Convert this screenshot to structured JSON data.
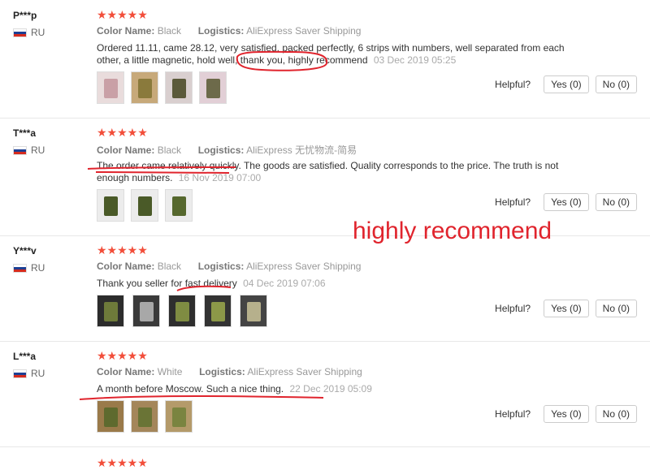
{
  "reviews": [
    {
      "user": "P***p",
      "country": "RU",
      "stars": "★★★★★",
      "color_label": "Color Name:",
      "color": "Black",
      "logistics_label": "Logistics:",
      "logistics": "AliExpress Saver Shipping",
      "text": "Ordered 11.11, came 28.12, very satisfied, packed perfectly, 6 strips with numbers, well separated from each other, a little magnetic, hold well, thank you, highly recommend",
      "date": "03 Dec 2019 05:25",
      "photos": 4,
      "helpful_label": "Helpful?",
      "yes_label": "Yes (0)",
      "no_label": "No (0)"
    },
    {
      "user": "T***a",
      "country": "RU",
      "stars": "★★★★★",
      "color_label": "Color Name:",
      "color": "Black",
      "logistics_label": "Logistics:",
      "logistics": "AliExpress 无忧物流-简易",
      "text": "The order came relatively quickly. The goods are satisfied. Quality corresponds to the price. The truth is not enough numbers.",
      "date": "16 Nov 2019 07:00",
      "photos": 3,
      "helpful_label": "Helpful?",
      "yes_label": "Yes (0)",
      "no_label": "No (0)"
    },
    {
      "user": "Y***v",
      "country": "RU",
      "stars": "★★★★★",
      "color_label": "Color Name:",
      "color": "Black",
      "logistics_label": "Logistics:",
      "logistics": "AliExpress Saver Shipping",
      "text": "Thank you seller for fast delivery",
      "date": "04 Dec 2019 07:06",
      "photos": 5,
      "helpful_label": "Helpful?",
      "yes_label": "Yes (0)",
      "no_label": "No (0)"
    },
    {
      "user": "L***a",
      "country": "RU",
      "stars": "★★★★★",
      "color_label": "Color Name:",
      "color": "White",
      "logistics_label": "Logistics:",
      "logistics": "AliExpress Saver Shipping",
      "text": "A month before Moscow. Such a nice thing.",
      "date": "22 Dec 2019 05:09",
      "photos": 3,
      "helpful_label": "Helpful?",
      "yes_label": "Yes (0)",
      "no_label": "No (0)"
    }
  ],
  "annotation": {
    "big_text": "highly recommend",
    "color": "#e0242d"
  },
  "colors": {
    "stars": "#f24e3a",
    "flag": [
      "#ffffff",
      "#1c3f94",
      "#d52b1e"
    ]
  }
}
